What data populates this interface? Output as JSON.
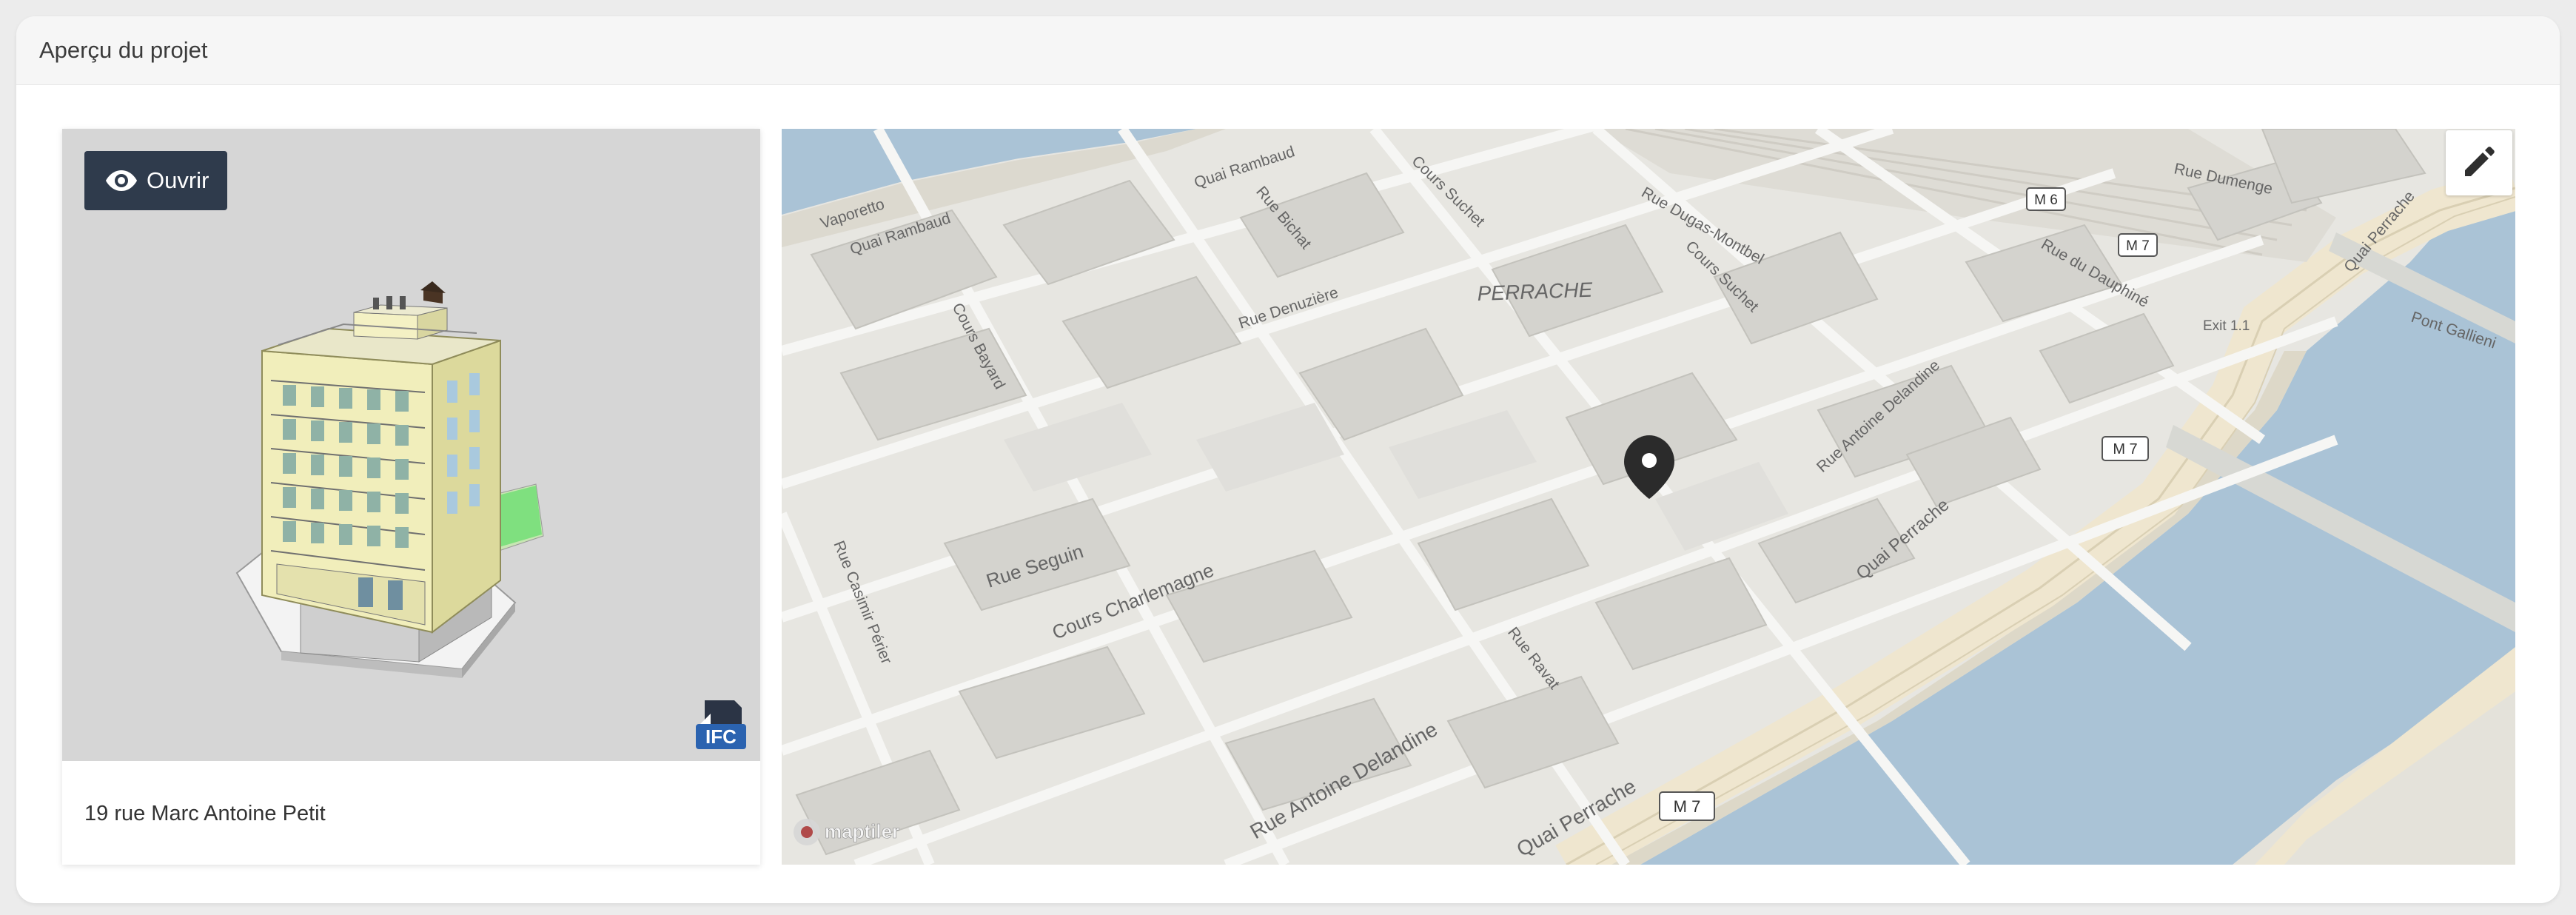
{
  "panel": {
    "title": "Aperçu du projet"
  },
  "card": {
    "open_button_label": "Ouvrir",
    "address": "19 rue Marc Antoine Petit",
    "file_badge": "IFC"
  },
  "map": {
    "attribution": "maptiler",
    "district_label": "PERRACHE",
    "street_labels": {
      "quai_rambaud_1": "Quai Rambaud",
      "quai_rambaud_2": "Quai Rambaud",
      "vaporetto": "Vaporetto",
      "rue_bichat": "Rue Bichat",
      "cours_bayard": "Cours Bayard",
      "rue_denuziere": "Rue Denuzière",
      "cours_suchet_1": "Cours Suchet",
      "cours_suchet_2": "Cours Suchet",
      "rue_dugas_montbel": "Rue Dugas-Montbel",
      "rue_du_dauphine": "Rue du Dauphiné",
      "rue_antoine_delandine_1": "Rue Antoine Delandine",
      "rue_antoine_delandine_2": "Rue Antoine Delandine",
      "quai_perrache_1": "Quai Perrache",
      "quai_perrache_2": "Quai Perrache",
      "quai_perrache_3": "Quai Perrache",
      "rue_seguin": "Rue Seguin",
      "cours_charlemagne": "Cours Charlemagne",
      "rue_casimir_perier": "Rue Casimir Périer",
      "rue_ravat": "Rue Ravat",
      "pont_gallieni": "Pont Gallieni",
      "rue_dumenge": "Rue Dumenge",
      "exit": "Exit 1.1"
    },
    "road_shields": [
      "M 6",
      "M 7",
      "M 7",
      "M 7"
    ],
    "colors": {
      "water": "#aac3d6",
      "land": "#e7e6e1",
      "road_major": "#efe6cf",
      "marker": "#2b2b2b"
    }
  },
  "icons": {
    "eye": "eye-icon",
    "edit": "pencil-icon",
    "marker": "map-marker-icon",
    "file": "ifc-file-icon"
  }
}
